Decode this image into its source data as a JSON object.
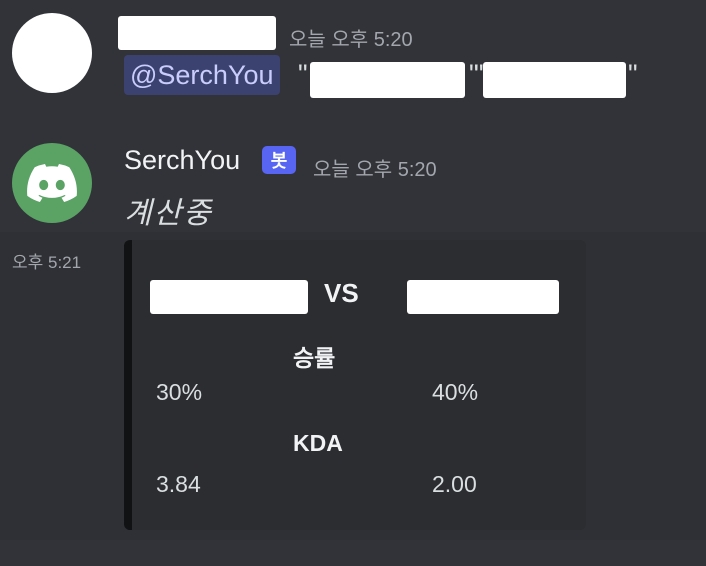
{
  "message1": {
    "timestamp": "오늘 오후 5:20",
    "mention": "@SerchYou",
    "quote_open_1": "\"",
    "quote_close_1": "\"",
    "quote_open_2": "\"",
    "quote_close_2": "\""
  },
  "message2": {
    "username": "SerchYou",
    "bot_tag": "봇",
    "timestamp": "오늘 오후 5:20",
    "status_text": "계산중",
    "side_time": "오후 5:21",
    "embed": {
      "vs_label": "VS",
      "fields": [
        {
          "name": "승률",
          "left": "30%",
          "right": "40%"
        },
        {
          "name": "KDA",
          "left": "3.84",
          "right": "2.00"
        }
      ]
    },
    "avatar_icon": "discord-logo-icon",
    "avatar_color": "#5aa365",
    "bot_tag_color": "#5865f2"
  }
}
